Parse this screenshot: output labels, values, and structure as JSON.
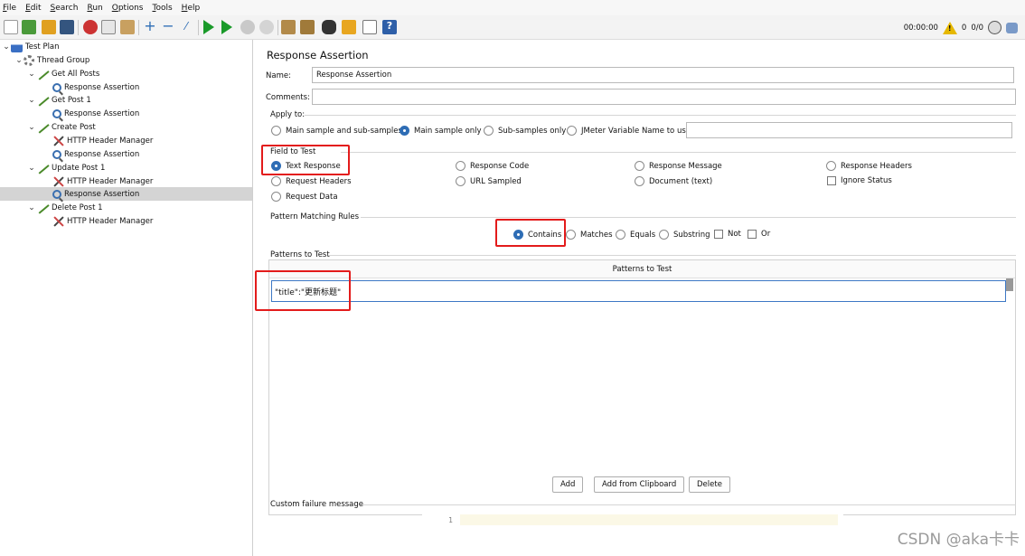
{
  "menu": [
    "File",
    "Edit",
    "Search",
    "Run",
    "Options",
    "Tools",
    "Help"
  ],
  "toolbar_icons": [
    "new-icon",
    "templates-icon",
    "open-icon",
    "save-icon",
    "cut-icon",
    "copy-icon",
    "paste-icon",
    "expand-icon",
    "collapse-icon",
    "toggle-icon",
    "start-icon",
    "start-no-pause-icon",
    "stop-icon",
    "shutdown-icon",
    "clear-icon",
    "clear-all-icon",
    "search-icon",
    "reset-search-icon",
    "function-helper-icon",
    "help-icon"
  ],
  "status": {
    "timer": "00:00:00",
    "warnings": "0",
    "threads": "0/0"
  },
  "tree": [
    {
      "label": "Test Plan",
      "icon": "test-plan-icon"
    },
    {
      "label": "Thread Group",
      "icon": "gear-icon"
    },
    {
      "label": "Get All Posts",
      "icon": "http-sampler-icon"
    },
    {
      "label": "Response Assertion",
      "icon": "magnifier-icon"
    },
    {
      "label": "Get Post 1",
      "icon": "http-sampler-icon"
    },
    {
      "label": "Response Assertion",
      "icon": "magnifier-icon"
    },
    {
      "label": "Create Post",
      "icon": "http-sampler-icon"
    },
    {
      "label": "HTTP Header Manager",
      "icon": "header-manager-icon"
    },
    {
      "label": "Response Assertion",
      "icon": "magnifier-icon"
    },
    {
      "label": "Update Post 1",
      "icon": "http-sampler-icon"
    },
    {
      "label": "HTTP Header Manager",
      "icon": "header-manager-icon"
    },
    {
      "label": "Response Assertion",
      "icon": "magnifier-icon",
      "selected": true
    },
    {
      "label": "Delete Post 1",
      "icon": "http-sampler-icon"
    },
    {
      "label": "HTTP Header Manager",
      "icon": "header-manager-icon"
    }
  ],
  "panel": {
    "title": "Response Assertion",
    "name_label": "Name:",
    "name_value": "Response Assertion",
    "comments_label": "Comments:",
    "comments_value": "",
    "apply_to_label": "Apply to:",
    "apply_to": [
      "Main sample and sub-samples",
      "Main sample only",
      "Sub-samples only",
      "JMeter Variable Name to use"
    ],
    "apply_to_selected": "Main sample only",
    "field_to_test_label": "Field to Test",
    "field_to_test": [
      "Text Response",
      "Response Code",
      "Response Message",
      "Response Headers",
      "Request Headers",
      "URL Sampled",
      "Document (text)",
      "Ignore Status",
      "Request Data"
    ],
    "field_to_test_selected": "Text Response",
    "pattern_rules_label": "Pattern Matching Rules",
    "pattern_rules": [
      "Contains",
      "Matches",
      "Equals",
      "Substring",
      "Not",
      "Or"
    ],
    "pattern_rules_selected": "Contains",
    "patterns_label": "Patterns to Test",
    "patterns_column": "Patterns to Test",
    "patterns": [
      "\"title\":\"更新标题\""
    ],
    "buttons": [
      "Add",
      "Add from Clipboard",
      "Delete"
    ],
    "failure_label": "Custom failure message",
    "line_number": "1"
  },
  "watermark": "CSDN @aka卡卡",
  "colors": {
    "highlight_red": "#e31b1b",
    "radio_on": "#2e6db5",
    "selection": "#d4d4d4"
  }
}
